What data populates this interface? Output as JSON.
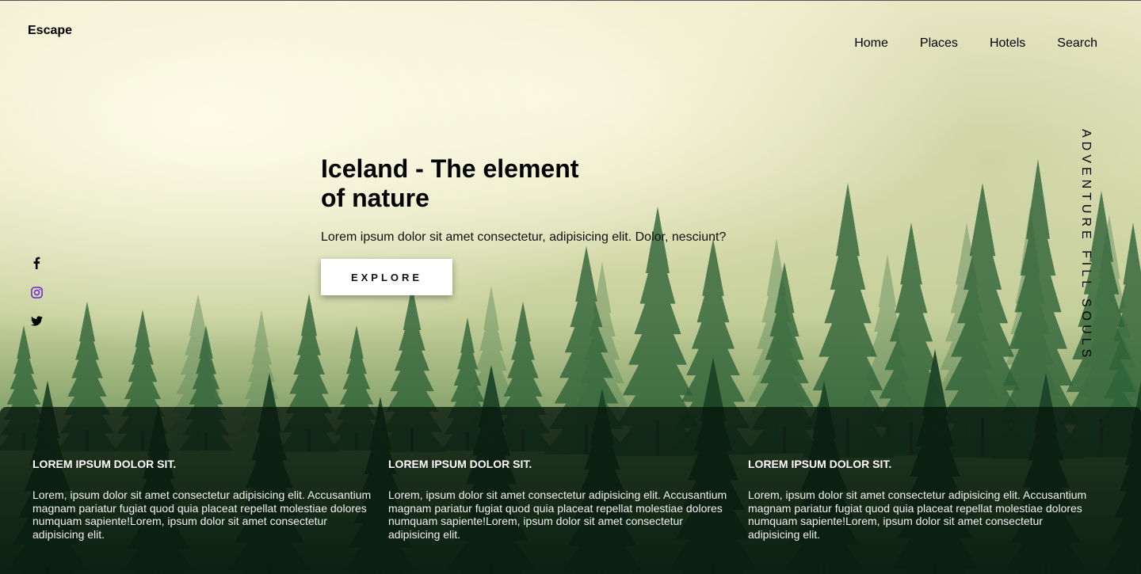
{
  "header": {
    "logo": "Escape",
    "nav": [
      "Home",
      "Places",
      "Hotels",
      "Search"
    ]
  },
  "social": {
    "icons": [
      "facebook-icon",
      "instagram-icon",
      "twitter-icon"
    ],
    "instagram_color": "#6b21d6"
  },
  "hero": {
    "title": "Iceland - The element of nature",
    "subtitle": "Lorem ipsum dolor sit amet consectetur, adipisicing elit. Dolor, nesciunt?",
    "button_label": "EXPLORE"
  },
  "tagline": "ADVENTURE FILL SOULS",
  "features": [
    {
      "title": "LOREM IPSUM DOLOR SIT.",
      "text": "Lorem, ipsum dolor sit amet consectetur adipisicing elit. Accusantium magnam pariatur fugiat quod quia placeat repellat molestiae dolores numquam sapiente!Lorem, ipsum dolor sit amet consectetur adipisicing elit."
    },
    {
      "title": "LOREM IPSUM DOLOR SIT.",
      "text": "Lorem, ipsum dolor sit amet consectetur adipisicing elit. Accusantium magnam pariatur fugiat quod quia placeat repellat molestiae dolores numquam sapiente!Lorem, ipsum dolor sit amet consectetur adipisicing elit."
    },
    {
      "title": "LOREM IPSUM DOLOR SIT.",
      "text": "Lorem, ipsum dolor sit amet consectetur adipisicing elit. Accusantium magnam pariatur fugiat quod quia placeat repellat molestiae dolores numquam sapiente!Lorem, ipsum dolor sit amet consectetur adipisicing elit."
    }
  ]
}
